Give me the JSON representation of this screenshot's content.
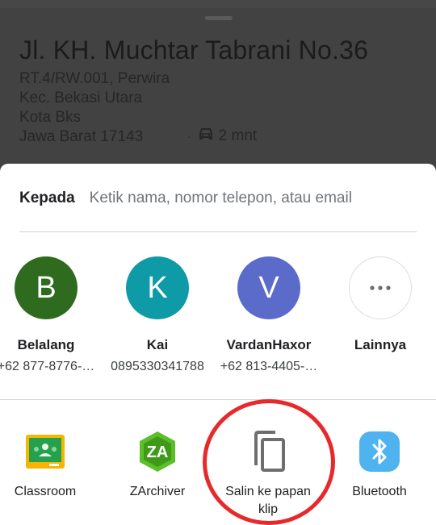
{
  "place": {
    "title": "Jl. KH. Muchtar Tabrani No.36",
    "lines": [
      "RT.4/RW.001, Perwira",
      "Kec. Bekasi Utara",
      "Kota Bks",
      "Jawa Barat 17143"
    ],
    "eta": "2 mnt",
    "eta_icon": "car-icon"
  },
  "share": {
    "to_label": "Kepada",
    "to_placeholder": "Ketik nama, nomor telepon, atau email",
    "contacts": [
      {
        "initial": "B",
        "name": "Belalang",
        "sub": "+62 877-8776-…",
        "color": "#2e6b1f"
      },
      {
        "initial": "K",
        "name": "Kai",
        "sub": "0895330341788",
        "color": "#0f9aa8"
      },
      {
        "initial": "V",
        "name": "VardanHaxor",
        "sub": "+62 813-4405-…",
        "color": "#5b6bc9"
      }
    ],
    "more": {
      "label": "Lainnya",
      "icon": "more-horiz-icon"
    },
    "apps": [
      {
        "label": "Classroom",
        "icon": "classroom-icon"
      },
      {
        "label": "ZArchiver",
        "icon": "zarchiver-icon"
      },
      {
        "label": "Salin ke papan klip",
        "icon": "copy-icon"
      },
      {
        "label": "Bluetooth",
        "icon": "bluetooth-icon"
      }
    ]
  },
  "colors": {
    "highlight_circle": "#e7292c",
    "bluetooth": "#4fb3f0",
    "classroom_green": "#24a14c",
    "classroom_yellow": "#f6b500"
  }
}
